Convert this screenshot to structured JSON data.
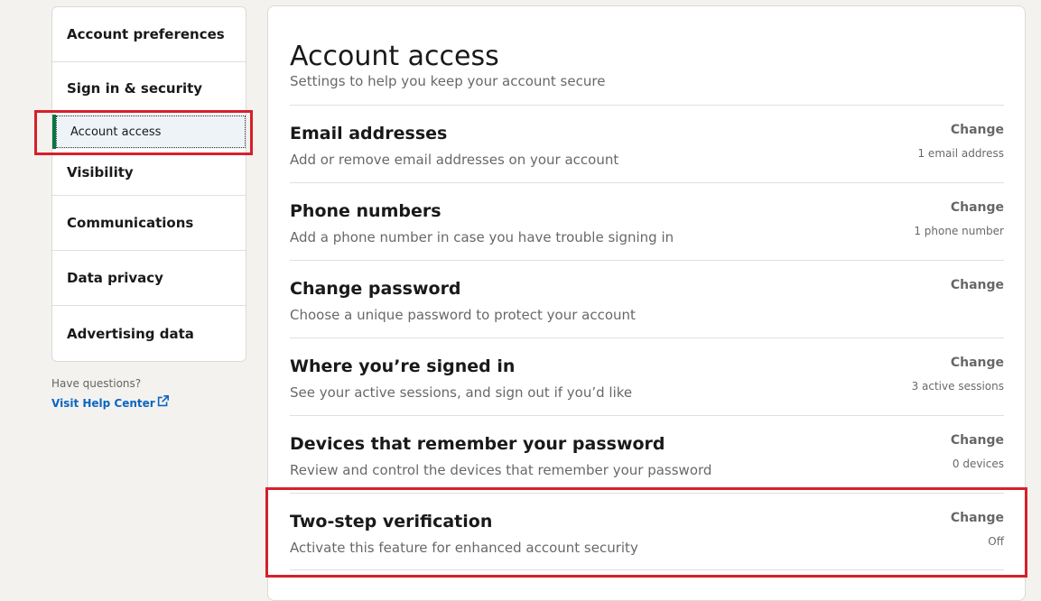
{
  "sidebar": {
    "items": [
      {
        "label": "Account preferences"
      },
      {
        "label": "Sign in & security"
      },
      {
        "label": "Account access"
      },
      {
        "label": "Visibility"
      },
      {
        "label": "Communications"
      },
      {
        "label": "Data privacy"
      },
      {
        "label": "Advertising data"
      }
    ],
    "help_question": "Have questions?",
    "help_link": "Visit Help Center"
  },
  "main": {
    "title": "Account access",
    "subtitle": "Settings to help you keep your account secure",
    "rows": [
      {
        "title": "Email addresses",
        "desc": "Add or remove email addresses on your account",
        "action": "Change",
        "meta": "1 email address"
      },
      {
        "title": "Phone numbers",
        "desc": "Add a phone number in case you have trouble signing in",
        "action": "Change",
        "meta": "1 phone number"
      },
      {
        "title": "Change password",
        "desc": "Choose a unique password to protect your account",
        "action": "Change",
        "meta": ""
      },
      {
        "title": "Where you’re signed in",
        "desc": "See your active sessions, and sign out if you’d like",
        "action": "Change",
        "meta": "3 active sessions"
      },
      {
        "title": "Devices that remember your password",
        "desc": "Review and control the devices that remember your password",
        "action": "Change",
        "meta": "0 devices"
      },
      {
        "title": "Two-step verification",
        "desc": "Activate this feature for enhanced account security",
        "action": "Change",
        "meta": "Off"
      }
    ]
  },
  "colors": {
    "accent": "#057642",
    "link": "#0a66c2",
    "highlight": "#d6202b"
  }
}
